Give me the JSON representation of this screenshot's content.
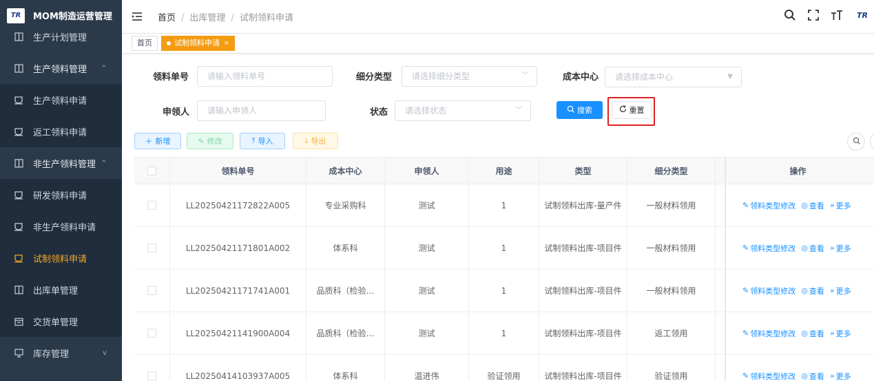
{
  "app": {
    "title": "MOM制造运营管理",
    "logo_text": "TR",
    "header_logo_text": "TR"
  },
  "sidebar": {
    "items": [
      {
        "label": "生产计划管理",
        "icon": "square-icon"
      },
      {
        "label": "生产领料管理",
        "icon": "square-icon",
        "arrow": "^"
      },
      {
        "label": "生产领料申请",
        "icon": "bookmark-icon"
      },
      {
        "label": "返工领料申请",
        "icon": "bookmark-icon"
      },
      {
        "label": "非生产领料管理",
        "icon": "square-icon",
        "arrow": "^"
      },
      {
        "label": "研发领料申请",
        "icon": "bookmark-icon"
      },
      {
        "label": "非生产领料申请",
        "icon": "bookmark-icon"
      },
      {
        "label": "试制领料申请",
        "icon": "bookmark-icon"
      },
      {
        "label": "出库单管理",
        "icon": "square-icon"
      },
      {
        "label": "交货单管理",
        "icon": "calendar-icon"
      },
      {
        "label": "库存管理",
        "icon": "monitor-icon",
        "arrow": "v"
      }
    ]
  },
  "breadcrumb": {
    "home": "首页",
    "level1": "出库管理",
    "level2": "试制领料申请",
    "sep": "/"
  },
  "tags": {
    "home": "首页",
    "active": "试制领料申请",
    "close": "×"
  },
  "search": {
    "order_no_label": "领料单号",
    "order_no_placeholder": "请输入领料单号",
    "subtype_label": "细分类型",
    "subtype_placeholder": "请选择细分类型",
    "cost_center_label": "成本中心",
    "cost_center_placeholder": "请选择成本中心",
    "applicant_label": "申领人",
    "applicant_placeholder": "请输入申领人",
    "status_label": "状态",
    "status_placeholder": "请选择状态",
    "search_button": "搜索",
    "reset_button": "重置"
  },
  "actions": {
    "add": "新增",
    "edit": "修改",
    "import": "导入",
    "export": "导出"
  },
  "table": {
    "headers": {
      "order_no": "领料单号",
      "cost_center": "成本中心",
      "applicant": "申领人",
      "purpose": "用途",
      "type": "类型",
      "subtype": "细分类型",
      "ops": "操作"
    },
    "ops": {
      "edit_type": "领料类型修改",
      "view": "查看",
      "more": "更多"
    },
    "rows": [
      {
        "order_no": "LL20250421172822A005",
        "cost_center": "专业采购科",
        "applicant": "测试",
        "purpose": "1",
        "type": "试制领料出库-量产件",
        "subtype": "一般材料领用"
      },
      {
        "order_no": "LL20250421171801A002",
        "cost_center": "体系科",
        "applicant": "测试",
        "purpose": "1",
        "type": "试制领料出库-项目件",
        "subtype": "一般材料领用"
      },
      {
        "order_no": "LL20250421171741A001",
        "cost_center": "品质科（检验…",
        "applicant": "测试",
        "purpose": "1",
        "type": "试制领料出库-项目件",
        "subtype": "一般材料领用"
      },
      {
        "order_no": "LL20250421141900A004",
        "cost_center": "品质科（检验…",
        "applicant": "测试",
        "purpose": "1",
        "type": "试制领料出库-项目件",
        "subtype": "返工领用"
      },
      {
        "order_no": "LL20250414103937A005",
        "cost_center": "体系科",
        "applicant": "温进伟",
        "purpose": "验证领用",
        "type": "试制领料出库-项目件",
        "subtype": "验证领用"
      }
    ]
  },
  "colors": {
    "sidebar_bg": "#2b3a4a",
    "accent_orange": "#f39c12",
    "primary_blue": "#1890ff",
    "highlight_red": "#e02020"
  }
}
